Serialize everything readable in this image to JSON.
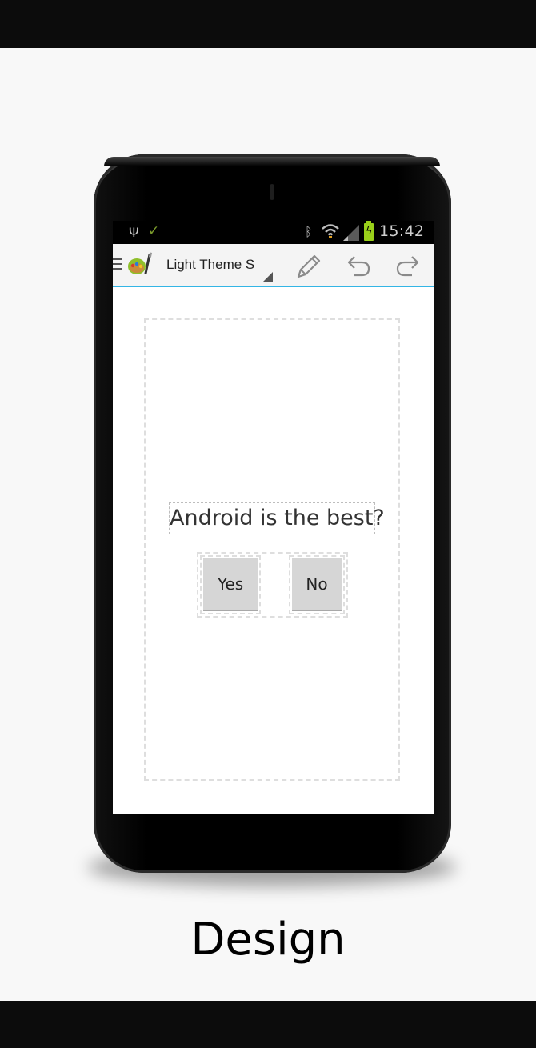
{
  "status_bar": {
    "icons": [
      "usb-icon",
      "check-icon",
      "bluetooth-icon",
      "wifi-icon",
      "signal-icon",
      "battery-charging-icon"
    ],
    "time": "15:42",
    "check_color": "#7a9a2b",
    "battery_color": "#9ad01a"
  },
  "action_bar": {
    "title": "Light Theme S",
    "actions": [
      "edit-icon",
      "undo-icon",
      "redo-icon"
    ],
    "accent_color": "#33b5e5"
  },
  "design": {
    "question": "Android is the best?",
    "yes_label": "Yes",
    "no_label": "No"
  },
  "caption": "Design"
}
